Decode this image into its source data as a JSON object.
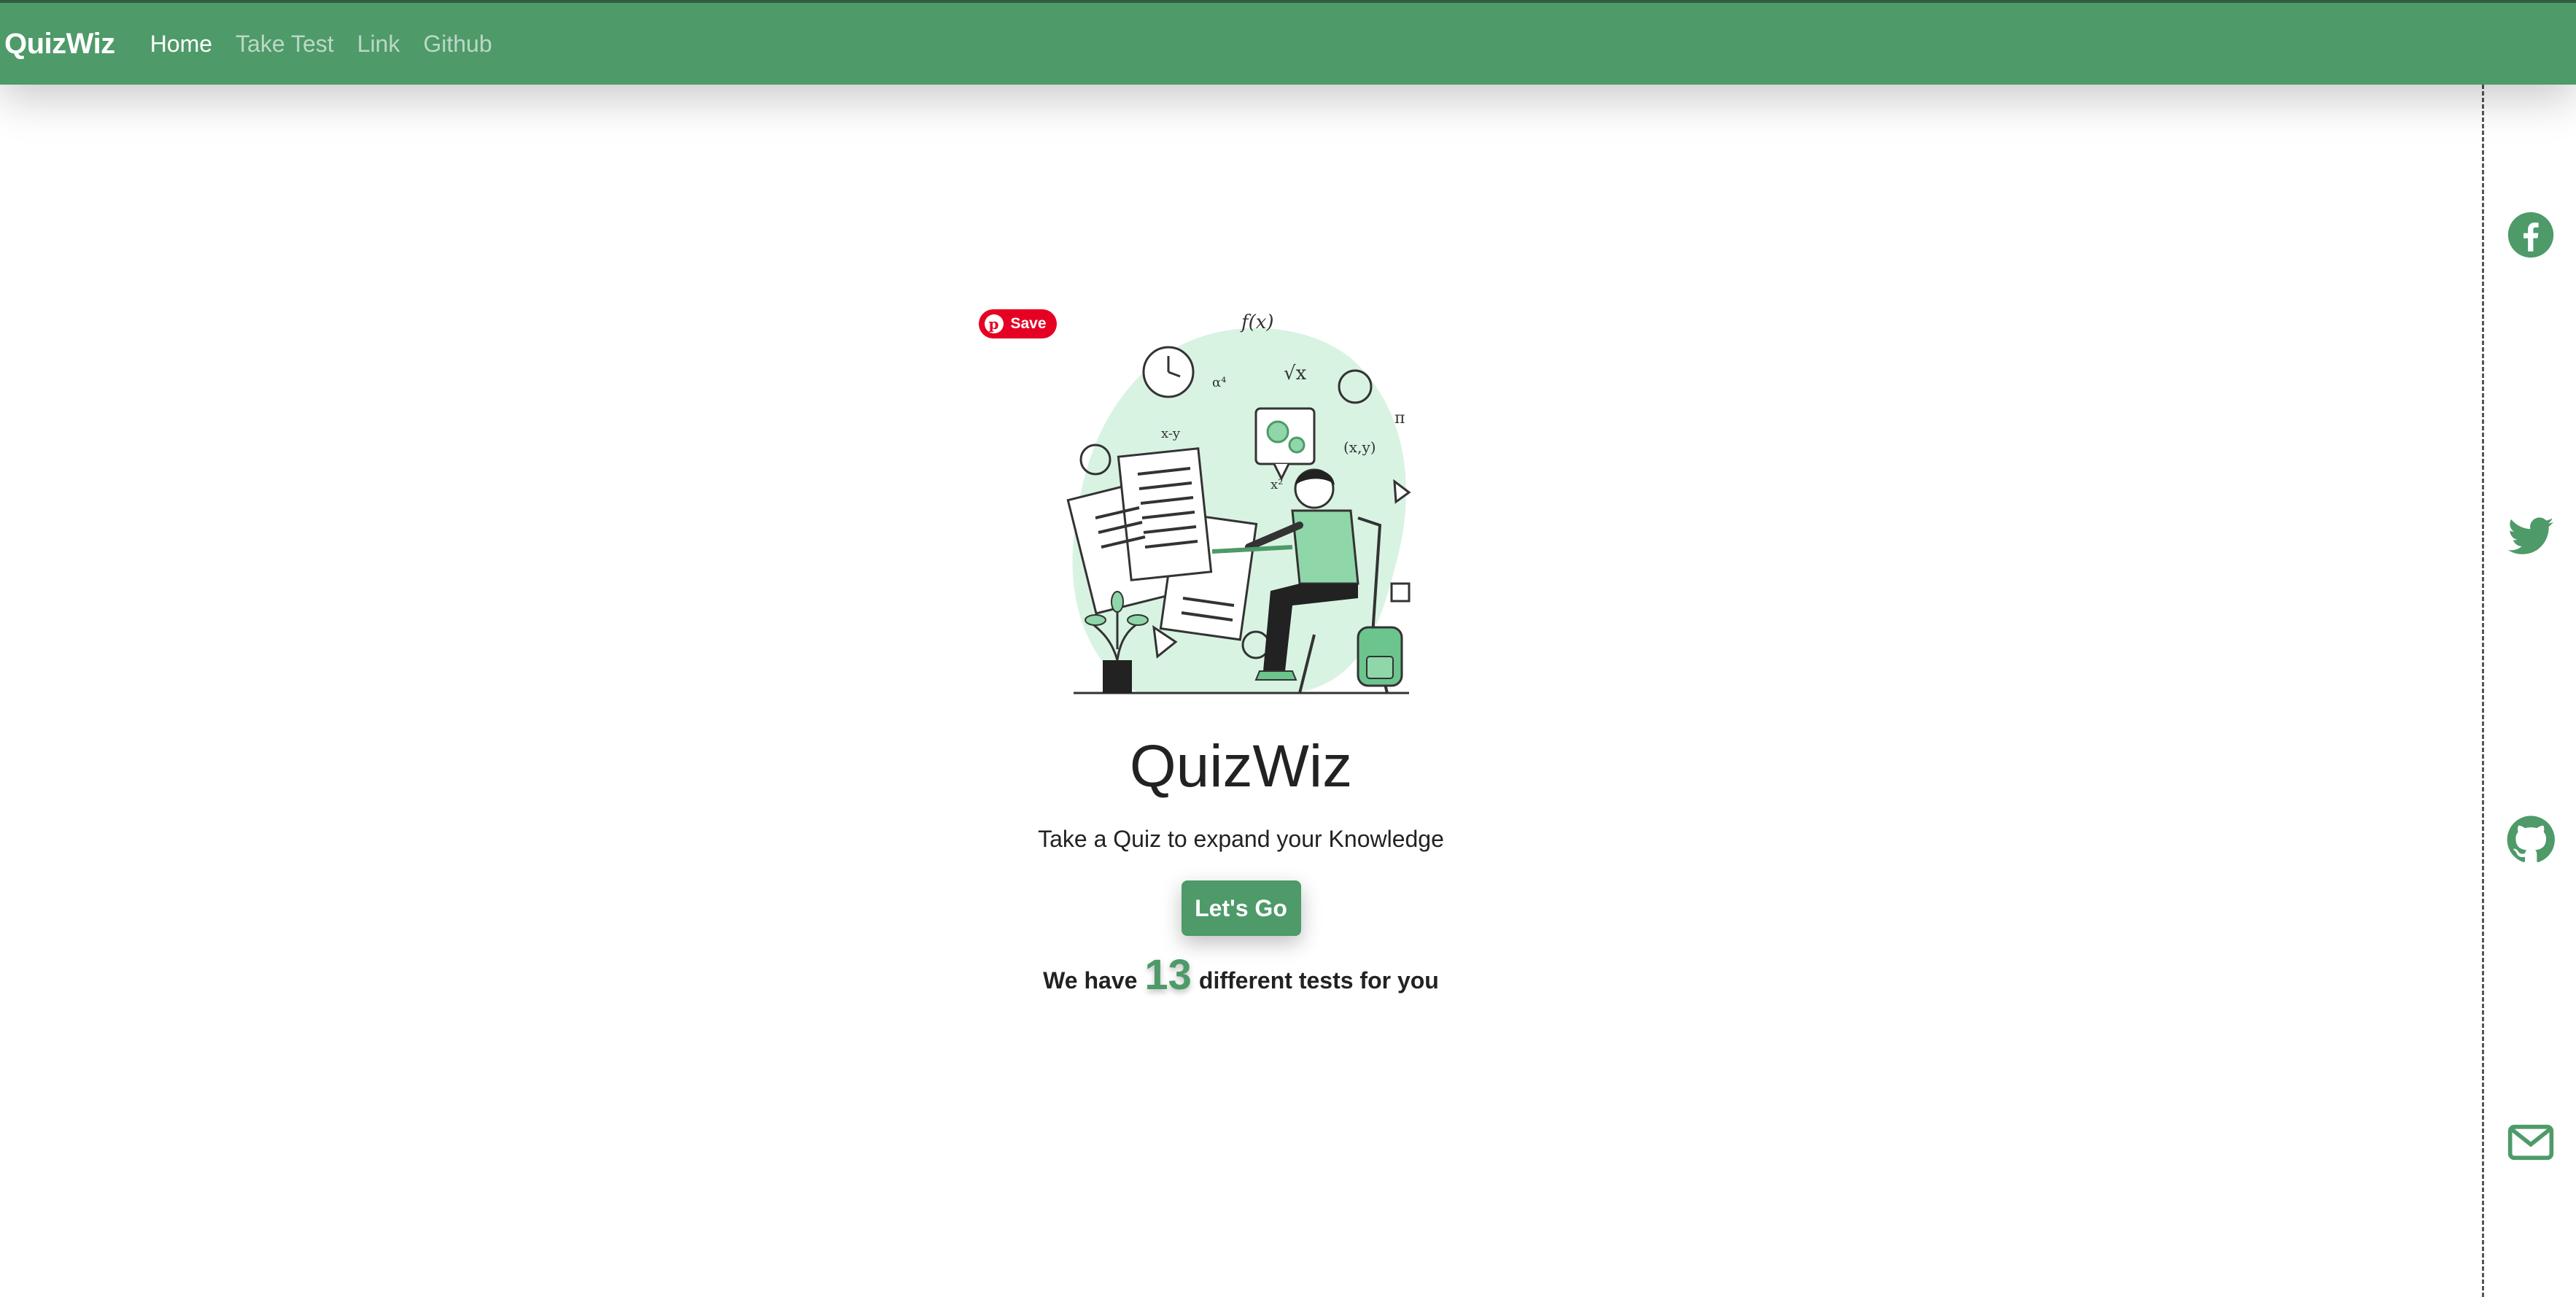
{
  "navbar": {
    "brand": "QuizWiz",
    "links": [
      {
        "label": "Home",
        "active": true
      },
      {
        "label": "Take Test",
        "active": false
      },
      {
        "label": "Link",
        "active": false
      },
      {
        "label": "Github",
        "active": false
      }
    ]
  },
  "social": [
    {
      "icon": "facebook-icon"
    },
    {
      "icon": "twitter-icon"
    },
    {
      "icon": "github-icon"
    },
    {
      "icon": "mail-icon"
    }
  ],
  "hero": {
    "save_badge": "Save",
    "title": "QuizWiz",
    "subtitle": "Take a Quiz to expand your Knowledge",
    "cta_label": "Let's Go",
    "count_prefix": "We have",
    "count_value": "13",
    "count_suffix": "different tests for you"
  },
  "colors": {
    "accent": "#4e9a69",
    "blob": "#d9f3e3",
    "pinterest": "#e60023"
  }
}
